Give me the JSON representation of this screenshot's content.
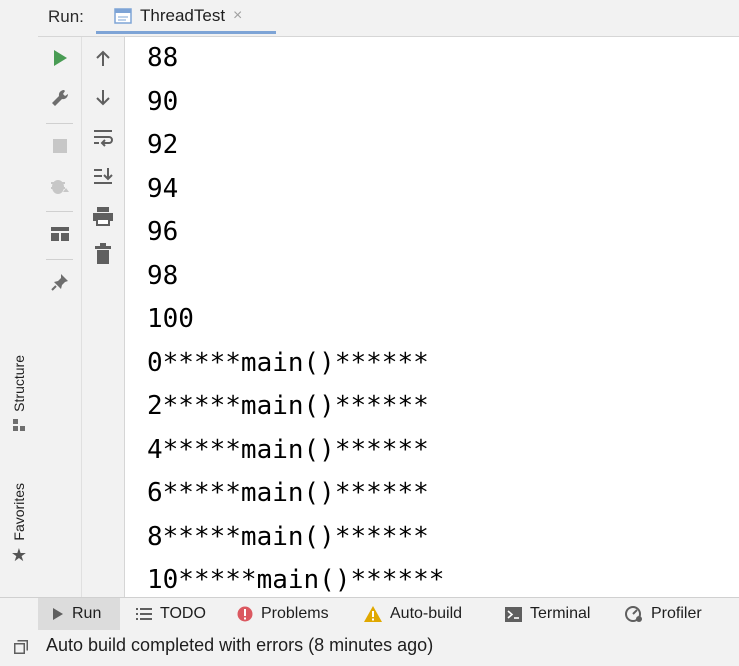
{
  "header": {
    "run_label": "Run:",
    "tab_title": "ThreadTest",
    "close_glyph": "×"
  },
  "left_strip": {
    "structure_label": "Structure",
    "favorites_label": "Favorites"
  },
  "toolbar_left": [
    "rerun-icon",
    "wrench-icon",
    "stop-icon",
    "debug-bug-icon",
    "layout-icon",
    "pin-icon"
  ],
  "toolbar_right": [
    "up-arrow-icon",
    "down-arrow-icon",
    "soft-wrap-icon",
    "scroll-to-end-icon",
    "print-icon",
    "trash-icon"
  ],
  "console": {
    "lines": [
      "88",
      "90",
      "92",
      "94",
      "96",
      "98",
      "100",
      "0*****main()******",
      "2*****main()******",
      "4*****main()******",
      "6*****main()******",
      "8*****main()******",
      "10*****main()******"
    ]
  },
  "bottom_tabs": [
    {
      "label": "Run",
      "icon": "run-icon",
      "active": true
    },
    {
      "label": "TODO",
      "icon": "list-icon"
    },
    {
      "label": "Problems",
      "icon": "error-icon"
    },
    {
      "label": "Auto-build",
      "icon": "warning-icon"
    },
    {
      "label": "Terminal",
      "icon": "terminal-icon"
    },
    {
      "label": "Profiler",
      "icon": "profiler-icon"
    }
  ],
  "status": {
    "text": "Auto build completed with errors (8 minutes ago)"
  },
  "colors": {
    "accent_tab_underline": "#7ea4d6",
    "run_green": "#499c54",
    "error_red": "#db5860",
    "warning_yellow": "#e0a800"
  }
}
